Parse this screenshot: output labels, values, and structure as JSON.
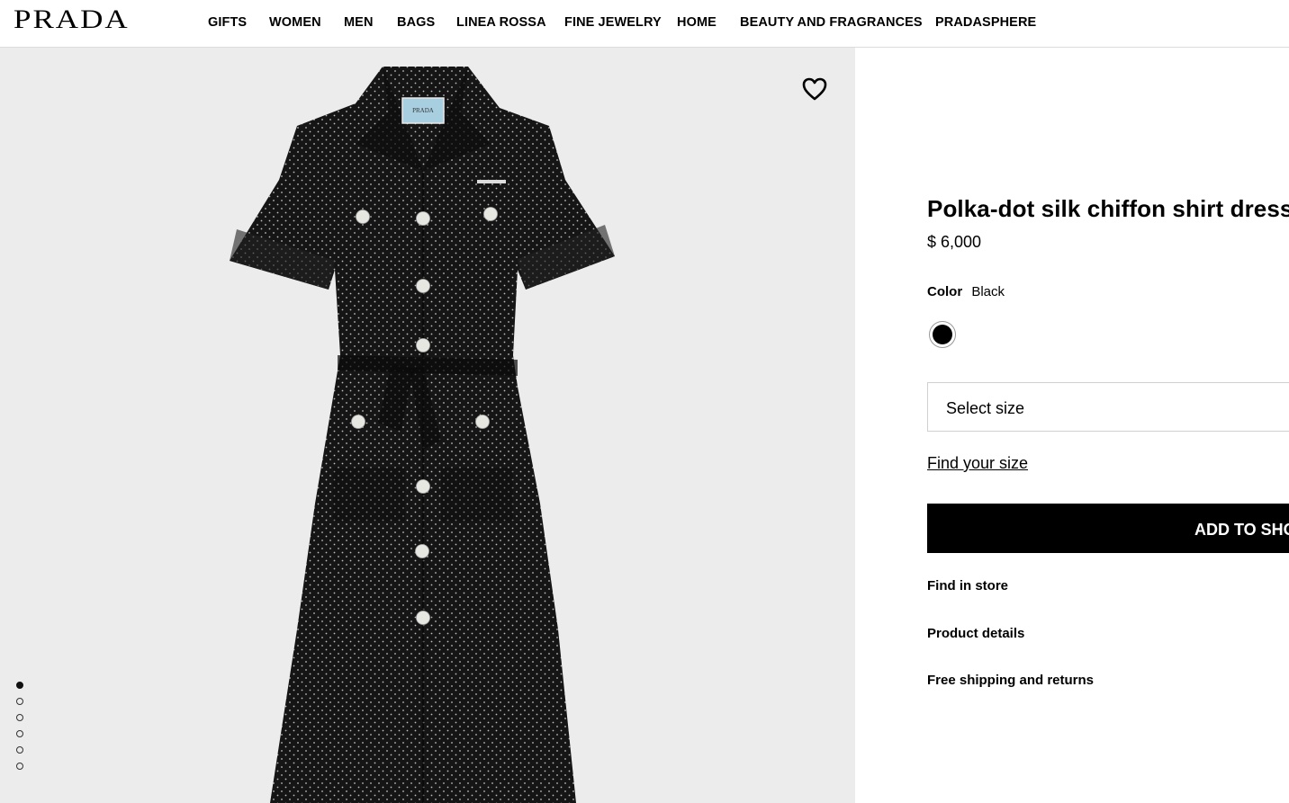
{
  "header": {
    "logo": "PRADA",
    "nav": [
      "GIFTS",
      "WOMEN",
      "MEN",
      "BAGS",
      "LINEA ROSSA",
      "FINE JEWELRY",
      "HOME",
      "BEAUTY AND FRAGRANCES",
      "PRADASPHERE"
    ]
  },
  "gallery": {
    "image_count": 6,
    "active_index": 0,
    "wishlist_icon": "heart-icon",
    "label_text": "PRADA"
  },
  "product": {
    "title": "Polka-dot silk chiffon shirt dress",
    "price": "$ 6,000",
    "color_label": "Color",
    "color_value": "Black",
    "swatch_color": "#000000",
    "size_placeholder": "Select size",
    "find_size": "Find your size",
    "add_to_cart": "ADD TO SHOPPING BAG",
    "links": [
      "Find in store",
      "Product details",
      "Free shipping and returns"
    ]
  }
}
